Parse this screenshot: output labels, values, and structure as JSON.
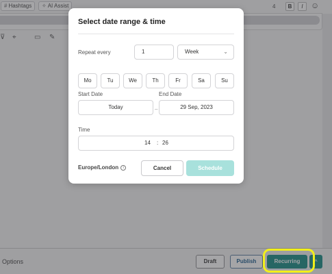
{
  "toolbar": {
    "hashtags_label": "Hashtags",
    "ai_assist_label": "AI Assist",
    "char_count": "4",
    "bold_label": "B",
    "italic_label": "I"
  },
  "bottom_bar": {
    "options_label": "Options",
    "draft_label": "Draft",
    "publish_label": "Publish",
    "recurring_label": "Recurring",
    "dropdown_icon": "chevron-up-icon"
  },
  "modal": {
    "title": "Select date range & time",
    "repeat": {
      "label": "Repeat every",
      "value": "1",
      "unit": "Week"
    },
    "days": [
      "Mo",
      "Tu",
      "We",
      "Th",
      "Fr",
      "Sa",
      "Su"
    ],
    "start_date": {
      "label": "Start Date",
      "value": "Today"
    },
    "end_date": {
      "label": "End Date",
      "value": "29 Sep, 2023"
    },
    "time": {
      "label": "Time",
      "hour": "14",
      "separator": ":",
      "minute": "26"
    },
    "timezone": "Europe/London",
    "cancel_label": "Cancel",
    "schedule_label": "Schedule"
  },
  "colors": {
    "accent": "#1b8c86",
    "accent_disabled": "#a8e1dc",
    "highlight": "#f2ef1a"
  }
}
